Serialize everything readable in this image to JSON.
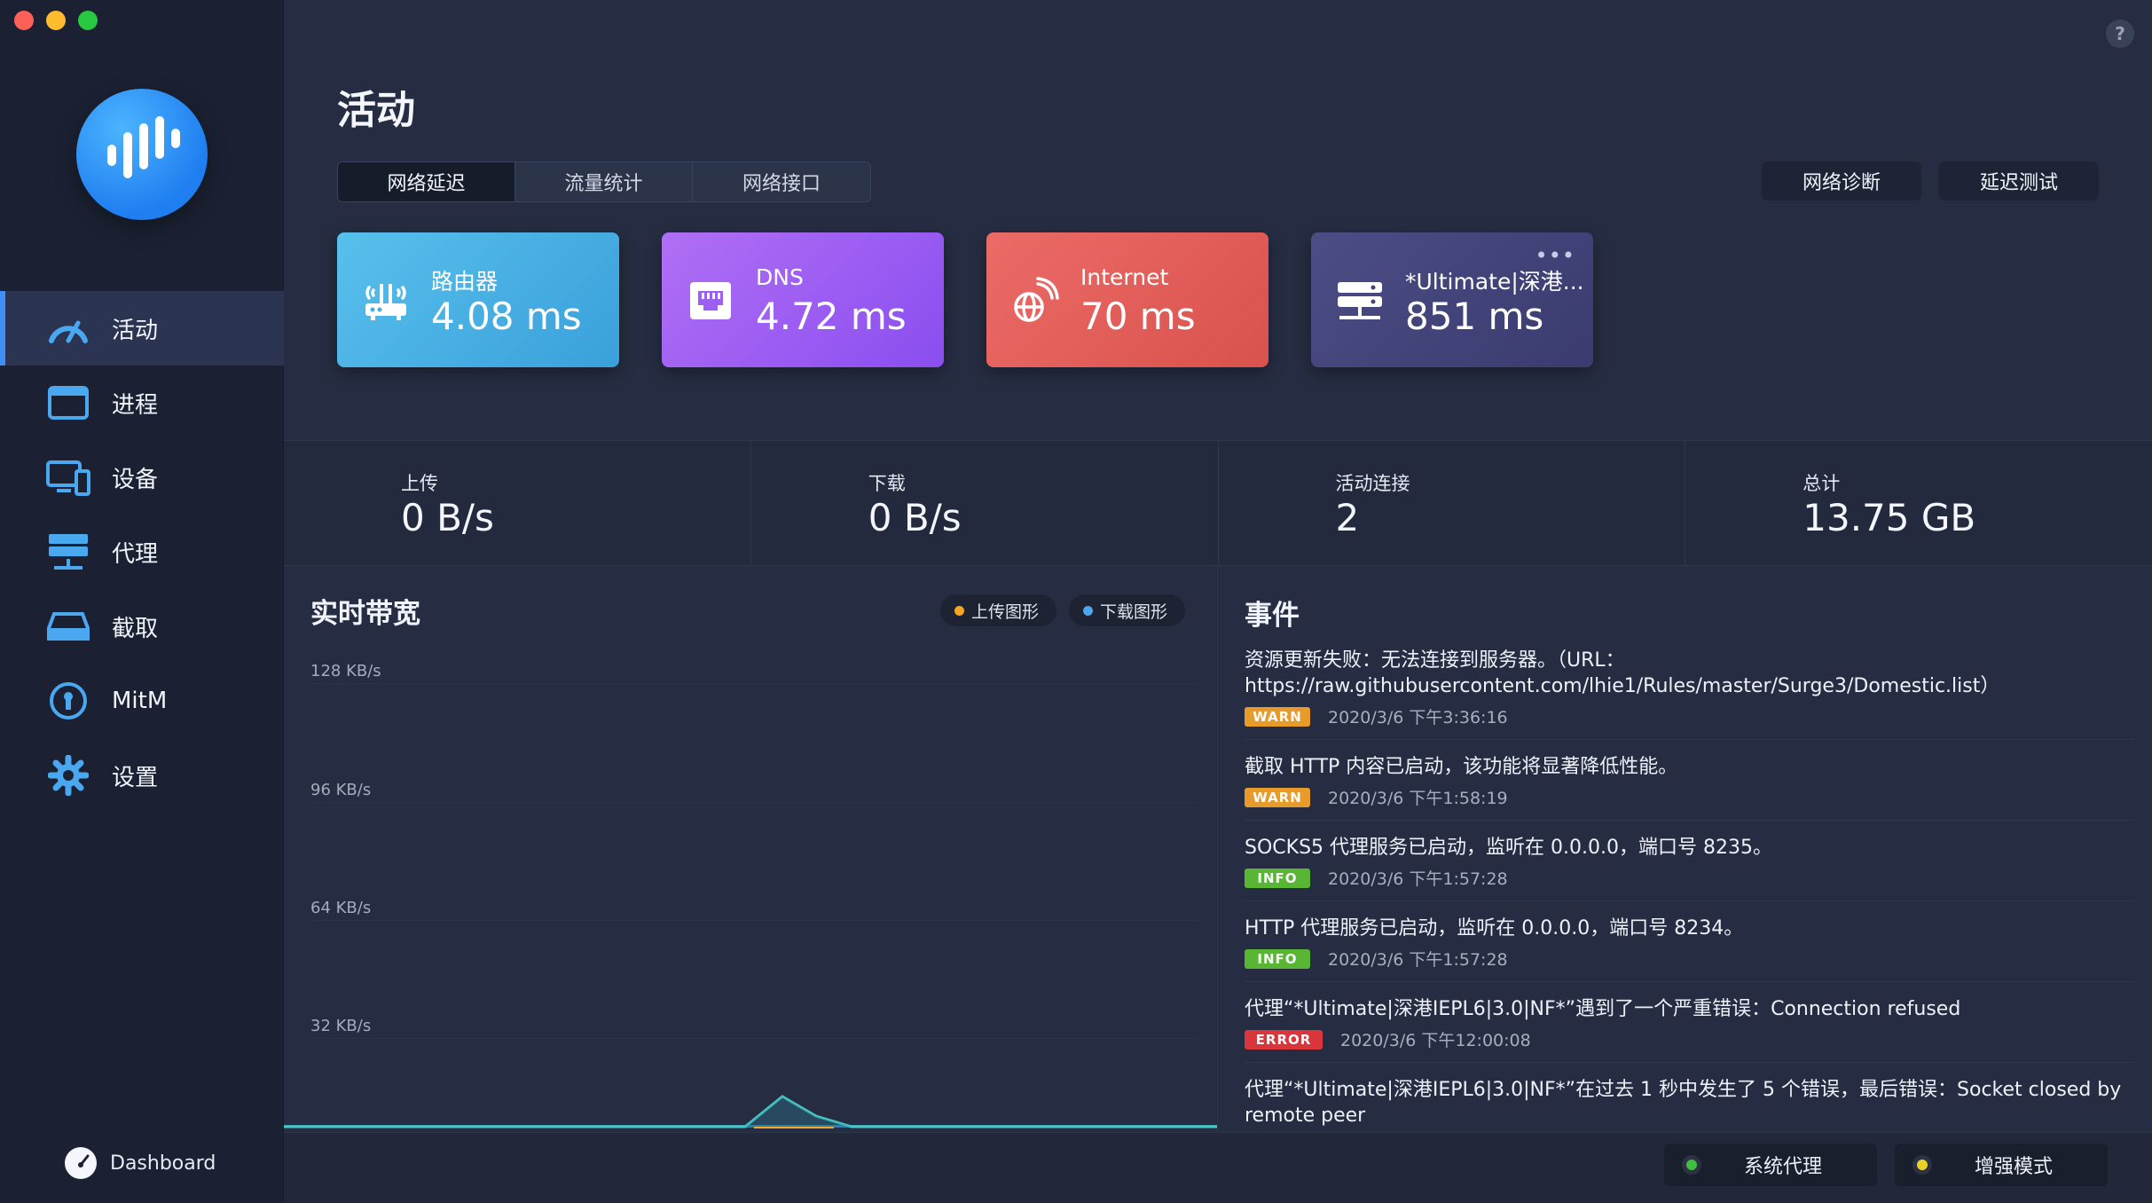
{
  "window": {
    "help_label": "?"
  },
  "sidebar": {
    "items": [
      {
        "label": "活动",
        "icon": "speedometer-icon"
      },
      {
        "label": "进程",
        "icon": "window-icon"
      },
      {
        "label": "设备",
        "icon": "devices-icon"
      },
      {
        "label": "代理",
        "icon": "server-icon"
      },
      {
        "label": "截取",
        "icon": "drive-icon"
      },
      {
        "label": "MitM",
        "icon": "keyhole-icon"
      },
      {
        "label": "设置",
        "icon": "gear-icon"
      }
    ],
    "dashboard_label": "Dashboard"
  },
  "header": {
    "title": "活动",
    "tabs": [
      {
        "label": "网络延迟"
      },
      {
        "label": "流量统计"
      },
      {
        "label": "网络接口"
      }
    ],
    "actions": [
      {
        "label": "网络诊断"
      },
      {
        "label": "延迟测试"
      }
    ]
  },
  "latency": [
    {
      "label": "路由器",
      "value": "4.08 ms"
    },
    {
      "label": "DNS",
      "value": "4.72 ms"
    },
    {
      "label": "Internet",
      "value": "70 ms"
    },
    {
      "label": "*Ultimate|深港...",
      "value": "851 ms",
      "more": "•••"
    }
  ],
  "stats": [
    {
      "label": "上传",
      "value": "0 B/s"
    },
    {
      "label": "下载",
      "value": "0 B/s"
    },
    {
      "label": "活动连接",
      "value": "2"
    },
    {
      "label": "总计",
      "value": "13.75 GB"
    }
  ],
  "bandwidth": {
    "title": "实时带宽",
    "legend": [
      {
        "label": "上传图形",
        "color": "#f5a623"
      },
      {
        "label": "下载图形",
        "color": "#4aa8f0"
      }
    ],
    "y_ticks": [
      "128 KB/s",
      "96 KB/s",
      "64 KB/s",
      "32 KB/s"
    ]
  },
  "events": {
    "title": "事件",
    "items": [
      {
        "text": "资源更新失败：无法连接到服务器。（URL：https://raw.githubusercontent.com/lhie1/Rules/master/Surge3/Domestic.list）",
        "level": "WARN",
        "time": "2020/3/6 下午3:36:16"
      },
      {
        "text": "截取 HTTP 内容已启动，该功能将显著降低性能。",
        "level": "WARN",
        "time": "2020/3/6 下午1:58:19"
      },
      {
        "text": "SOCKS5 代理服务已启动，监听在 0.0.0.0，端口号 8235。",
        "level": "INFO",
        "time": "2020/3/6 下午1:57:28"
      },
      {
        "text": "HTTP 代理服务已启动，监听在 0.0.0.0，端口号 8234。",
        "level": "INFO",
        "time": "2020/3/6 下午1:57:28"
      },
      {
        "text": "代理“*Ultimate|深港IEPL6|3.0|NF*”遇到了一个严重错误：Connection refused",
        "level": "ERROR",
        "time": "2020/3/6 下午12:00:08"
      },
      {
        "text": "代理“*Ultimate|深港IEPL6|3.0|NF*”在过去 1 秒中发生了 5 个错误，最后错误：Socket closed by remote peer",
        "level": "",
        "time": ""
      }
    ]
  },
  "bottom": {
    "system_proxy": {
      "label": "系统代理",
      "status_color": "#3fbf3f"
    },
    "enhanced_mode": {
      "label": "增强模式",
      "status_color": "#e8d22a"
    }
  }
}
